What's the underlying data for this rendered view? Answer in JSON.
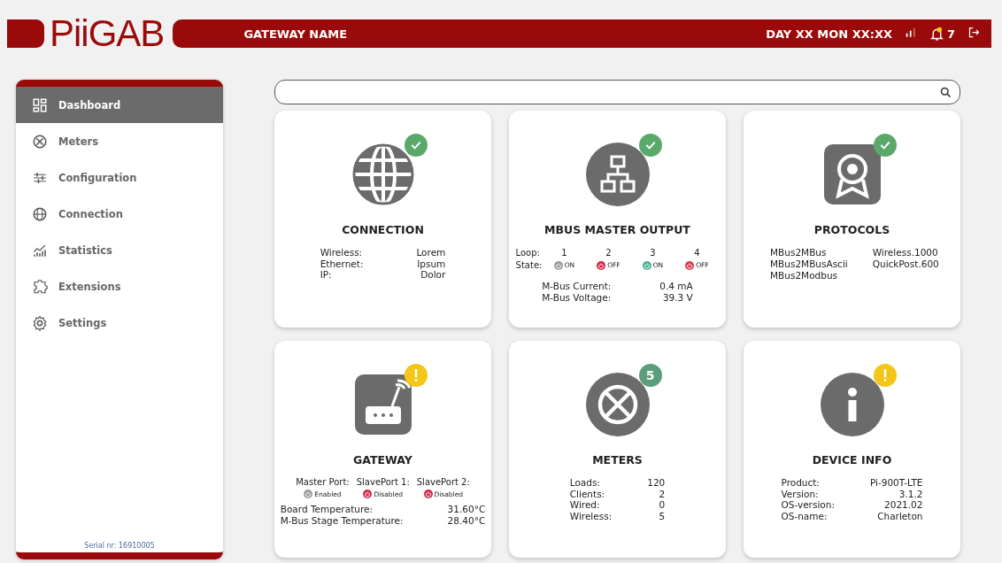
{
  "header": {
    "logo": "PiiGAB",
    "gateway_name": "GATEWAY NAME",
    "datetime": "DAY XX MON XX:XX",
    "notifications": "7"
  },
  "sidebar": {
    "items": [
      {
        "label": "Dashboard",
        "selected": true
      },
      {
        "label": "Meters",
        "selected": false
      },
      {
        "label": "Configuration",
        "selected": false
      },
      {
        "label": "Connection",
        "selected": false
      },
      {
        "label": "Statistics",
        "selected": false
      },
      {
        "label": "Extensions",
        "selected": false
      },
      {
        "label": "Settings",
        "selected": false
      }
    ],
    "serial": "Serial nr: 16910005"
  },
  "cards": [
    {
      "kind": "kv",
      "title": "CONNECTION",
      "badge": {
        "kind": "check"
      },
      "rows": [
        {
          "label": "Wireless:",
          "value": "Lorem"
        },
        {
          "label": "Ethernet:",
          "value": "Ipsum"
        },
        {
          "label": "IP:",
          "value": "Dolor"
        }
      ]
    },
    {
      "kind": "mbus",
      "title": "MBUS MASTER OUTPUT",
      "badge": {
        "kind": "check"
      },
      "loop_label": "Loop:",
      "state_label": "State:",
      "loops": [
        {
          "number": "1",
          "state": "ON",
          "color": "#9a9a9a"
        },
        {
          "number": "2",
          "state": "OFF",
          "color": "#d0284a"
        },
        {
          "number": "3",
          "state": "ON",
          "color": "#4caf8a"
        },
        {
          "number": "4",
          "state": "OFF",
          "color": "#e0344a"
        }
      ],
      "rows": [
        {
          "label": "M-Bus Current:",
          "value": "0.4 mA"
        },
        {
          "label": "M-Bus Voltage:",
          "value": "39.3 V"
        }
      ]
    },
    {
      "kind": "protocols",
      "title": "PROTOCOLS",
      "badge": {
        "kind": "check"
      },
      "columns": [
        [
          "MBus2MBus",
          "MBus2MBusAscii",
          "MBus2Modbus"
        ],
        [
          "Wireless.1000",
          "QuickPost.600"
        ]
      ]
    },
    {
      "kind": "gateway",
      "title": "GATEWAY",
      "badge": {
        "kind": "warning"
      },
      "ports": [
        {
          "label": "Master Port:",
          "state": "Enabled",
          "color": "#9a9a9a"
        },
        {
          "label": "SlavePort 1:",
          "state": "Disabled",
          "color": "#d0284a"
        },
        {
          "label": "SlavePort 2:",
          "state": "Disabled",
          "color": "#d0284a"
        }
      ],
      "rows": [
        {
          "label": "Board Temperature:",
          "value": "31.60°C"
        },
        {
          "label": "M-Bus Stage Temperature:",
          "value": "28.40°C"
        }
      ]
    },
    {
      "kind": "kv",
      "title": "METERS",
      "badge": {
        "kind": "count",
        "text": "5"
      },
      "rows": [
        {
          "label": "Loads:",
          "value": "120"
        },
        {
          "label": "Clients:",
          "value": "2"
        },
        {
          "label": "Wired:",
          "value": "0"
        },
        {
          "label": "Wireless:",
          "value": "5"
        }
      ]
    },
    {
      "kind": "kv",
      "title": "DEVICE INFO",
      "badge": {
        "kind": "warning"
      },
      "rows": [
        {
          "label": "Product:",
          "value": "Pi-900T-LTE"
        },
        {
          "label": "Version:",
          "value": "3.1.2"
        },
        {
          "label": "OS-version:",
          "value": "2021.02"
        },
        {
          "label": "OS-name:",
          "value": "Charleton"
        }
      ]
    }
  ]
}
